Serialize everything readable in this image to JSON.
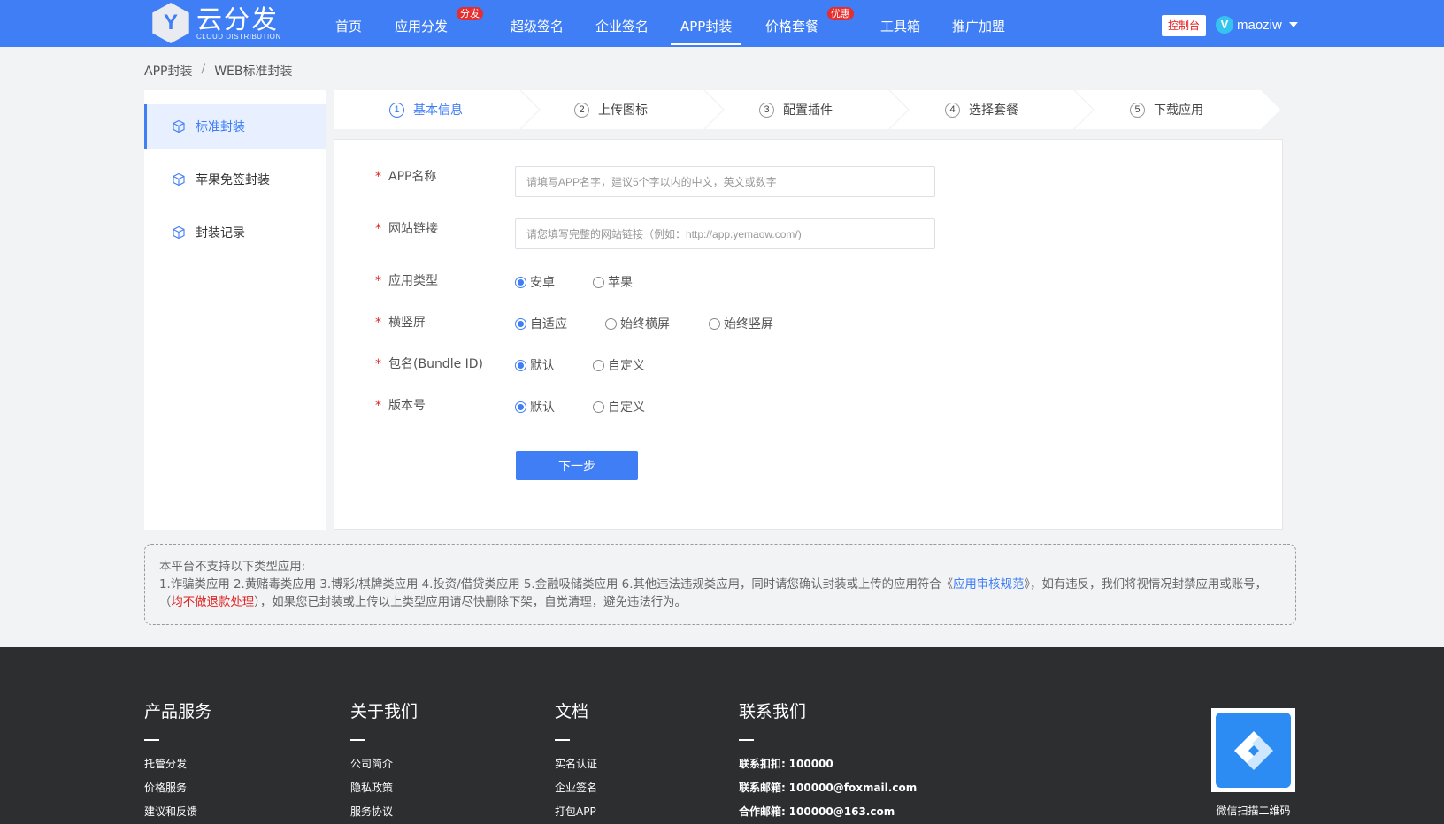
{
  "header": {
    "logo_letter": "Y",
    "logo_name": "云分发",
    "logo_sub": "CLOUD DISTRIBUTION",
    "nav": [
      {
        "label": "首页"
      },
      {
        "label": "应用分发",
        "badge": "分发"
      },
      {
        "label": "超级签名"
      },
      {
        "label": "企业签名"
      },
      {
        "label": "APP封装",
        "active": true
      },
      {
        "label": "价格套餐",
        "badge": "优惠"
      },
      {
        "label": "工具箱"
      },
      {
        "label": "推广加盟"
      }
    ],
    "console_label": "控制台",
    "user_initial": "V",
    "username": "maoziw"
  },
  "breadcrumb": {
    "root": "APP封装",
    "sep": "/",
    "current": "WEB标准封装"
  },
  "sidebar": {
    "items": [
      {
        "label": "标准封装",
        "active": true
      },
      {
        "label": "苹果免签封装"
      },
      {
        "label": "封装记录"
      }
    ]
  },
  "steps": [
    {
      "num": "1",
      "label": "基本信息",
      "active": true
    },
    {
      "num": "2",
      "label": "上传图标"
    },
    {
      "num": "3",
      "label": "配置插件"
    },
    {
      "num": "4",
      "label": "选择套餐"
    },
    {
      "num": "5",
      "label": "下载应用"
    }
  ],
  "form": {
    "required_mark": "*",
    "app_name": {
      "label": "APP名称",
      "value": "",
      "placeholder": "请填写APP名字，建议5个字以内的中文，英文或数字"
    },
    "site_url": {
      "label": "网站链接",
      "value": "",
      "placeholder": "请您填写完整的网站链接（例如：http://app.yemaow.com/)"
    },
    "app_type": {
      "label": "应用类型",
      "options": [
        "安卓",
        "苹果"
      ],
      "selected": "安卓"
    },
    "orientation": {
      "label": "横竖屏",
      "options": [
        "自适应",
        "始终横屏",
        "始终竖屏"
      ],
      "selected": "自适应"
    },
    "bundle_id": {
      "label": "包名(Bundle ID)",
      "options": [
        "默认",
        "自定义"
      ],
      "selected": "默认"
    },
    "version": {
      "label": "版本号",
      "options": [
        "默认",
        "自定义"
      ],
      "selected": "默认"
    },
    "next_label": "下一步"
  },
  "notice": {
    "line1": "本平台不支持以下类型应用:",
    "line2_a": "1.诈骗类应用 2.黄赌毒类应用 3.博彩/棋牌类应用 4.投资/借贷类应用 5.金融吸储类应用 6.其他违法违规类应用，同时请您确认封装或上传的应用符合《",
    "link": "应用审核规范",
    "line2_b": "》，如有违反，我们将视情况封禁应用或账号，（",
    "warn": "均不做退款处理",
    "line2_c": "），如果您已封装或上传以上类型应用请尽快删除下架，自觉清理，避免违法行为。"
  },
  "footer": {
    "products": {
      "title": "产品服务",
      "links": [
        "托管分发",
        "价格服务",
        "建议和反馈"
      ]
    },
    "about": {
      "title": "关于我们",
      "links": [
        "公司简介",
        "隐私政策",
        "服务协议"
      ]
    },
    "docs": {
      "title": "文档",
      "links": [
        "实名认证",
        "企业签名",
        "打包APP"
      ]
    },
    "contact": {
      "title": "联系我们",
      "items": [
        {
          "label": "联系扣扣:",
          "value": "100000"
        },
        {
          "label": "联系邮箱:",
          "value": "100000@foxmail.com"
        },
        {
          "label": "合作邮箱:",
          "value": "100000@163.com"
        }
      ]
    },
    "qr_caption": "微信扫描二维码"
  },
  "colors": {
    "primary": "#3f7ef5",
    "danger": "#e02424",
    "footer_bg": "#2d2e30"
  }
}
